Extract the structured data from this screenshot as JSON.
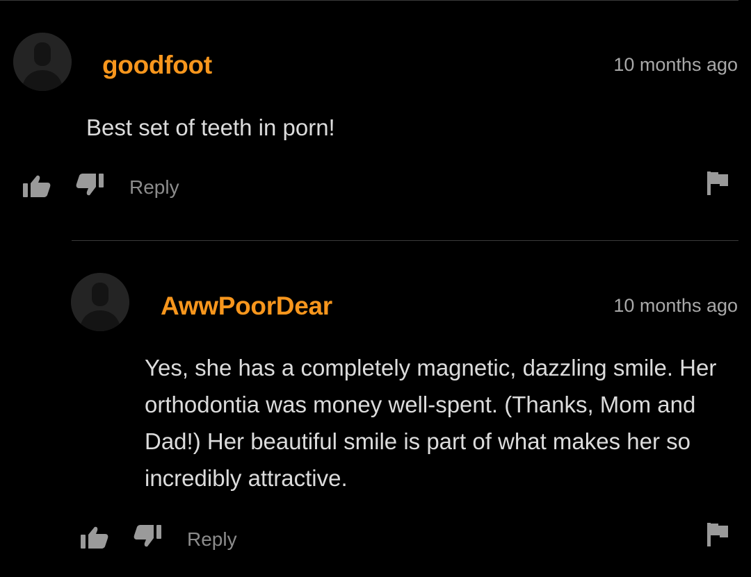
{
  "comments": [
    {
      "username": "goodfoot",
      "timestamp": "10 months ago",
      "text": "Best set of teeth in porn!",
      "reply_label": "Reply"
    },
    {
      "username": "AwwPoorDear",
      "timestamp": "10 months ago",
      "text": "Yes, she has a completely magnetic, dazzling smile. Her orthodontia was money well-spent. (Thanks, Mom and Dad!) Her beautiful smile is part of what makes her so incredibly attractive.",
      "reply_label": "Reply"
    }
  ],
  "colors": {
    "background": "#000000",
    "username": "#f7961d",
    "timestamp": "#a9a9a9",
    "body_text": "#dcdcdc",
    "action_icons": "#9a9a9a",
    "divider": "#3b3b3b"
  },
  "icons": [
    "avatar-icon",
    "thumbs-up-icon",
    "thumbs-down-icon",
    "flag-icon"
  ]
}
